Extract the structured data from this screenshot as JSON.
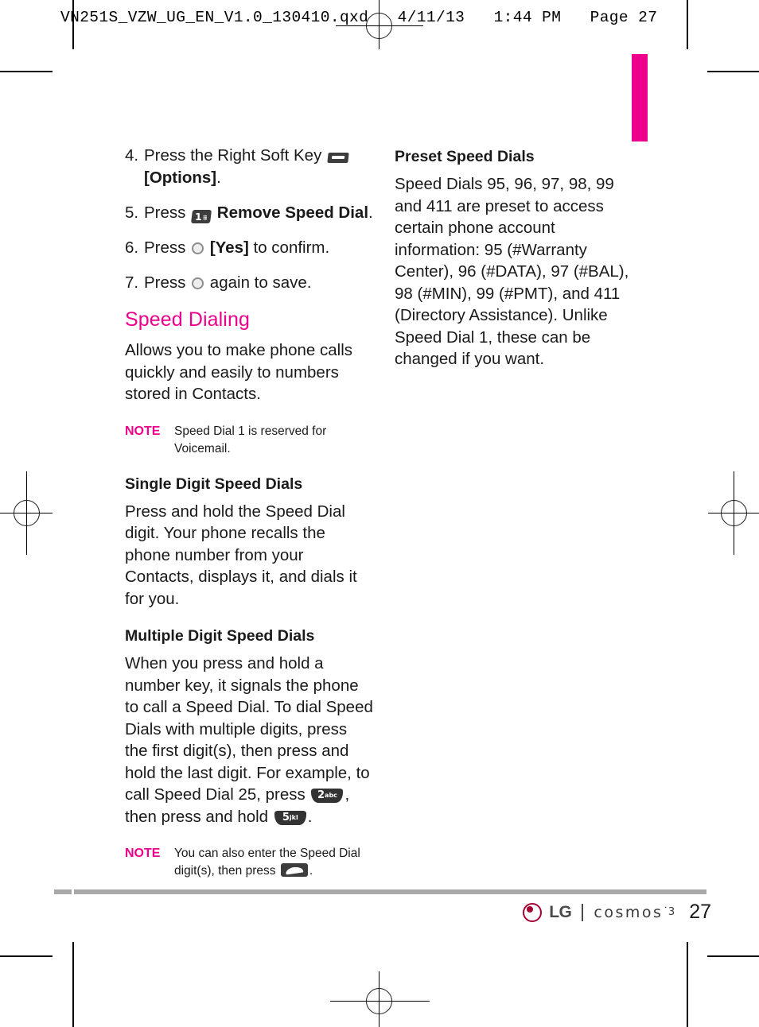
{
  "print_header": "VN251S_VZW_UG_EN_V1.0_130410.qxd   4/11/13   1:44 PM   Page 27",
  "side_tab_color": "#ec008c",
  "accent_color": "#ec008c",
  "left_column": {
    "steps": [
      {
        "num": "4.",
        "text_before": "Press the Right Soft Key",
        "icon": "right-soft-key-icon",
        "text_after_bold": "[Options]",
        "text_after": "."
      },
      {
        "num": "5.",
        "text_before": "Press",
        "icon": "key-1-icon",
        "text_after_bold": "Remove Speed Dial",
        "text_after": "."
      },
      {
        "num": "6.",
        "text_before": "Press",
        "icon": "ok-key-icon",
        "text_after_bold": "[Yes]",
        "text_after": " to confirm."
      },
      {
        "num": "7.",
        "text_before": "Press",
        "icon": "ok-key-icon",
        "text_after_bold": "",
        "text_after": " again to save."
      }
    ],
    "heading": "Speed Dialing",
    "intro": "Allows you to make phone calls quickly and easily to numbers stored in Contacts.",
    "note1": {
      "label": "NOTE",
      "text": "Speed Dial 1 is reserved for Voicemail."
    },
    "section1": {
      "heading": "Single Digit Speed Dials",
      "body": "Press and hold the Speed Dial digit. Your phone recalls the phone number from your Contacts, displays it, and dials it for you."
    },
    "section2": {
      "heading": "Multiple Digit Speed Dials",
      "body_part1": "When you press and hold a number key, it signals the phone to call a Speed Dial. To dial Speed Dials with multiple digits, press the first digit(s), then press and hold the last digit. For example, to call Speed Dial 25, press",
      "key_2_digit": "2",
      "key_2_sub": "abc",
      "body_part2": ", then press and hold",
      "key_5_digit": "5",
      "key_5_sub": "jkl",
      "body_part3": "."
    },
    "note2": {
      "label": "NOTE",
      "text_before": "You can also enter the Speed Dial digit(s), then press",
      "icon": "send-key-icon",
      "text_after": "."
    }
  },
  "right_column": {
    "heading": "Preset Speed Dials",
    "body": "Speed Dials 95, 96, 97, 98, 99 and 411 are preset to access certain phone account information: 95 (#Warranty Center), 96 (#DATA), 97 (#BAL), 98 (#MIN), 99 (#PMT), and 411 (Directory Assistance). Unlike Speed Dial 1, these can be changed if you want."
  },
  "footer": {
    "brand": "LG",
    "product": "cosmos",
    "product_sup": "˙3",
    "page_number": "27"
  }
}
